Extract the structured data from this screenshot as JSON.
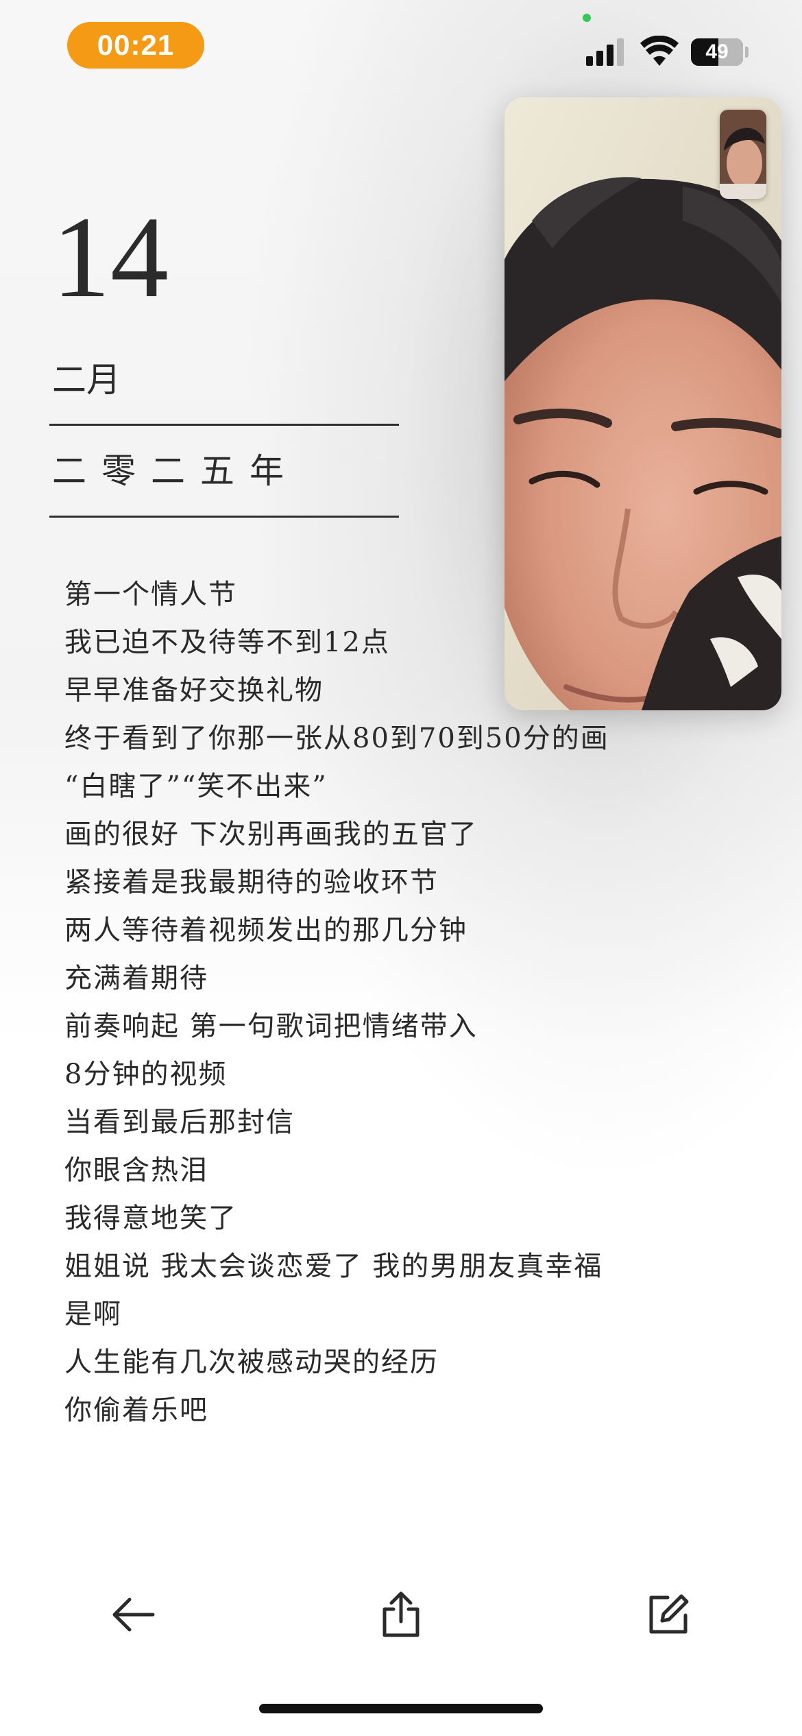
{
  "status_bar": {
    "time": "00:21",
    "battery_percent": "49",
    "signal_bars_active": 3,
    "signal_bars_total": 4,
    "time_pill_color": "#f59a14"
  },
  "date": {
    "day": "14",
    "month": "二月",
    "year": "二零二五年"
  },
  "poem": {
    "lines": [
      "第一个情人节",
      "我已迫不及待等不到12点",
      "早早准备好交换礼物",
      "终于看到了你那一张从80到70到50分的画",
      "“白瞎了”“笑不出来”",
      "画的很好 下次别再画我的五官了",
      "紧接着是我最期待的验收环节",
      "两人等待着视频发出的那几分钟",
      "充满着期待",
      "前奏响起 第一句歌词把情绪带入",
      "8分钟的视频",
      "当看到最后那封信",
      "你眼含热泪",
      "我得意地笑了",
      "姐姐说 我太会谈恋爱了 我的男朋友真幸福",
      "是啊",
      "人生能有几次被感动哭的经历",
      "你偷着乐吧"
    ]
  },
  "video_call": {
    "remote_feed_icon": "person-video-feed",
    "self_view_icon": "self-view-thumbnail"
  },
  "toolbar": {
    "back_icon": "arrow-left-icon",
    "share_icon": "share-icon",
    "edit_icon": "compose-icon"
  }
}
